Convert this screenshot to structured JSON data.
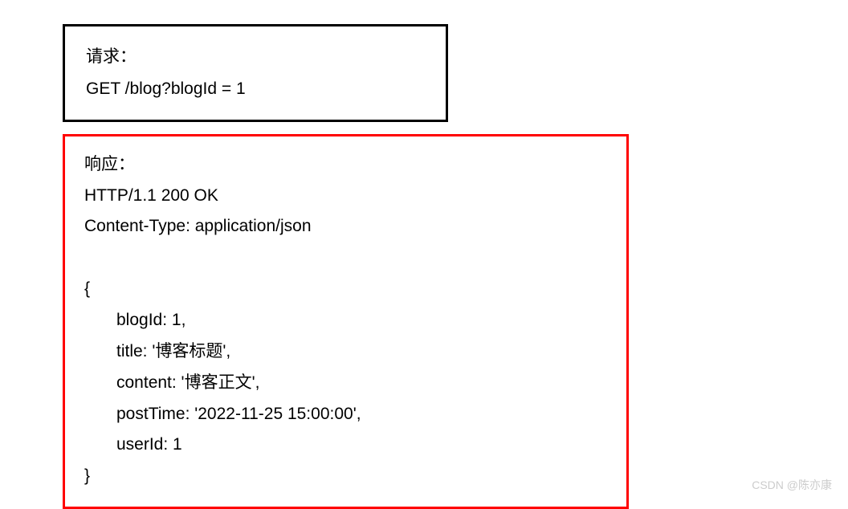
{
  "request": {
    "label": "请求：",
    "line": "GET /blog?blogId = 1"
  },
  "response": {
    "label": "响应：",
    "statusLine": "HTTP/1.1 200 OK",
    "contentType": "Content-Type: application/json",
    "bodyOpen": "{",
    "bodyLines": [
      "blogId: 1,",
      "title: '博客标题',",
      "content: '博客正文',",
      "postTime: '2022-11-25 15:00:00',",
      "userId: 1"
    ],
    "bodyClose": "}"
  },
  "watermark": "CSDN @陈亦康"
}
